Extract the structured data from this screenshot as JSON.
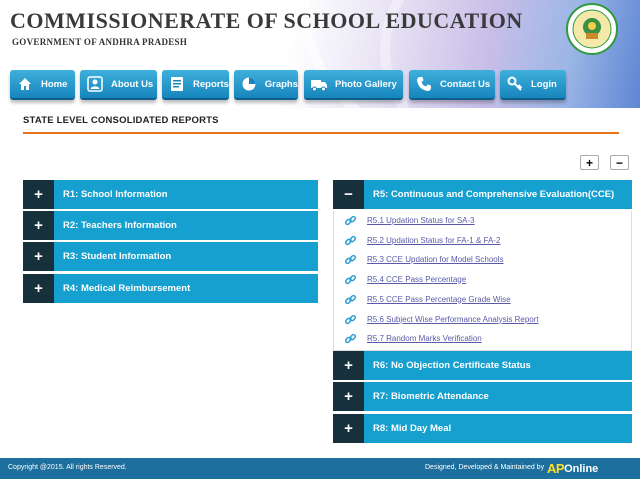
{
  "header": {
    "title": "COMMISSIONERATE OF SCHOOL EDUCATION",
    "subtitle": "GOVERNMENT OF ANDHRA PRADESH"
  },
  "nav": [
    {
      "label": "Home",
      "icon": "home-icon"
    },
    {
      "label": "About Us",
      "icon": "person-icon"
    },
    {
      "label": "Reports",
      "icon": "report-icon"
    },
    {
      "label": "Graphs",
      "icon": "pie-chart-icon"
    },
    {
      "label": "Photo Gallery",
      "icon": "truck-icon"
    },
    {
      "label": "Contact Us",
      "icon": "phone-icon"
    },
    {
      "label": "Login",
      "icon": "key-icon"
    }
  ],
  "section": {
    "title": "STATE LEVEL CONSOLIDATED REPORTS",
    "expand_all": "+",
    "collapse_all": "−"
  },
  "left_reports": [
    {
      "toggle": "+",
      "label": "R1: School Information"
    },
    {
      "toggle": "+",
      "label": "R2: Teachers Information"
    },
    {
      "toggle": "+",
      "label": "R3: Student Information"
    },
    {
      "toggle": "+",
      "label": "R4: Medical Reimbursement"
    }
  ],
  "r5": {
    "toggle": "−",
    "label": "R5: Continuous and Comprehensive Evaluation(CCE)",
    "links": [
      "R5.1 Updation Status for SA-3",
      "R5.2 Updation Status for FA-1 & FA-2",
      "R5.3 CCE Updation for Model Schools",
      "R5.4 CCE Pass Percentage",
      "R5.5 CCE Pass Percentage Grade Wise",
      "R5.6 Subject Wise Performance Analysis Report",
      "R5.7 Random Marks Verification"
    ]
  },
  "right_reports": [
    {
      "toggle": "+",
      "label": "R6: No Objection Certificate Status"
    },
    {
      "toggle": "+",
      "label": "R7: Biometric Attendance"
    },
    {
      "toggle": "+",
      "label": "R8: Mid Day Meal"
    }
  ],
  "footer": {
    "copyright": "Copyright @2015. All rights Reserved.",
    "credit": "Designed, Developed & Maintained by",
    "logo_ap": "AP",
    "logo_online": "Online"
  },
  "colors": {
    "accordion": "#16a0cf",
    "toggle": "#16303c",
    "nav_button": "#1785bd",
    "rule": "#e8731e",
    "footer": "#1d6f9d"
  }
}
